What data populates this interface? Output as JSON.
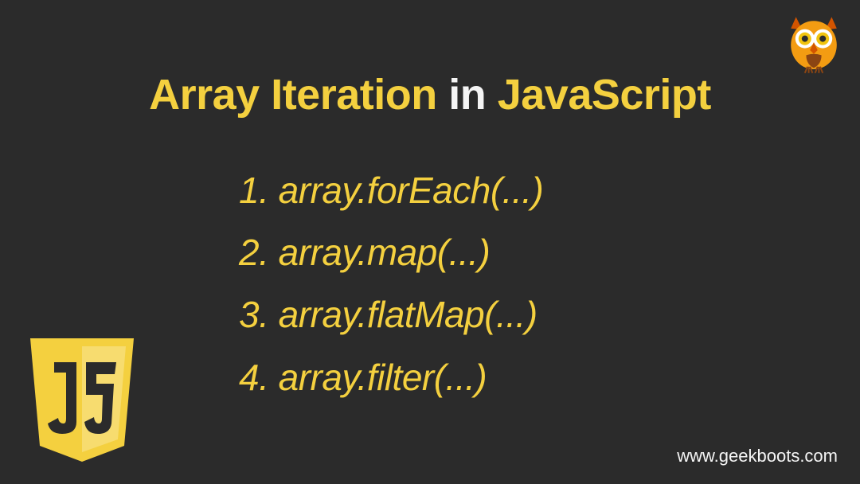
{
  "title": {
    "part1": "Array Iteration",
    "part2": " in ",
    "part3": "JavaScript"
  },
  "items": [
    "1. array.forEach(...)",
    "2. array.map(...)",
    "3. array.flatMap(...)",
    "4. array.filter(...)"
  ],
  "footer_url": "www.geekboots.com",
  "colors": {
    "background": "#2b2b2b",
    "accent": "#f4d03f",
    "text_light": "#f5f5f5",
    "owl_orange": "#e67e22",
    "owl_brown": "#8b4513",
    "js_yellow": "#f4d03f"
  }
}
